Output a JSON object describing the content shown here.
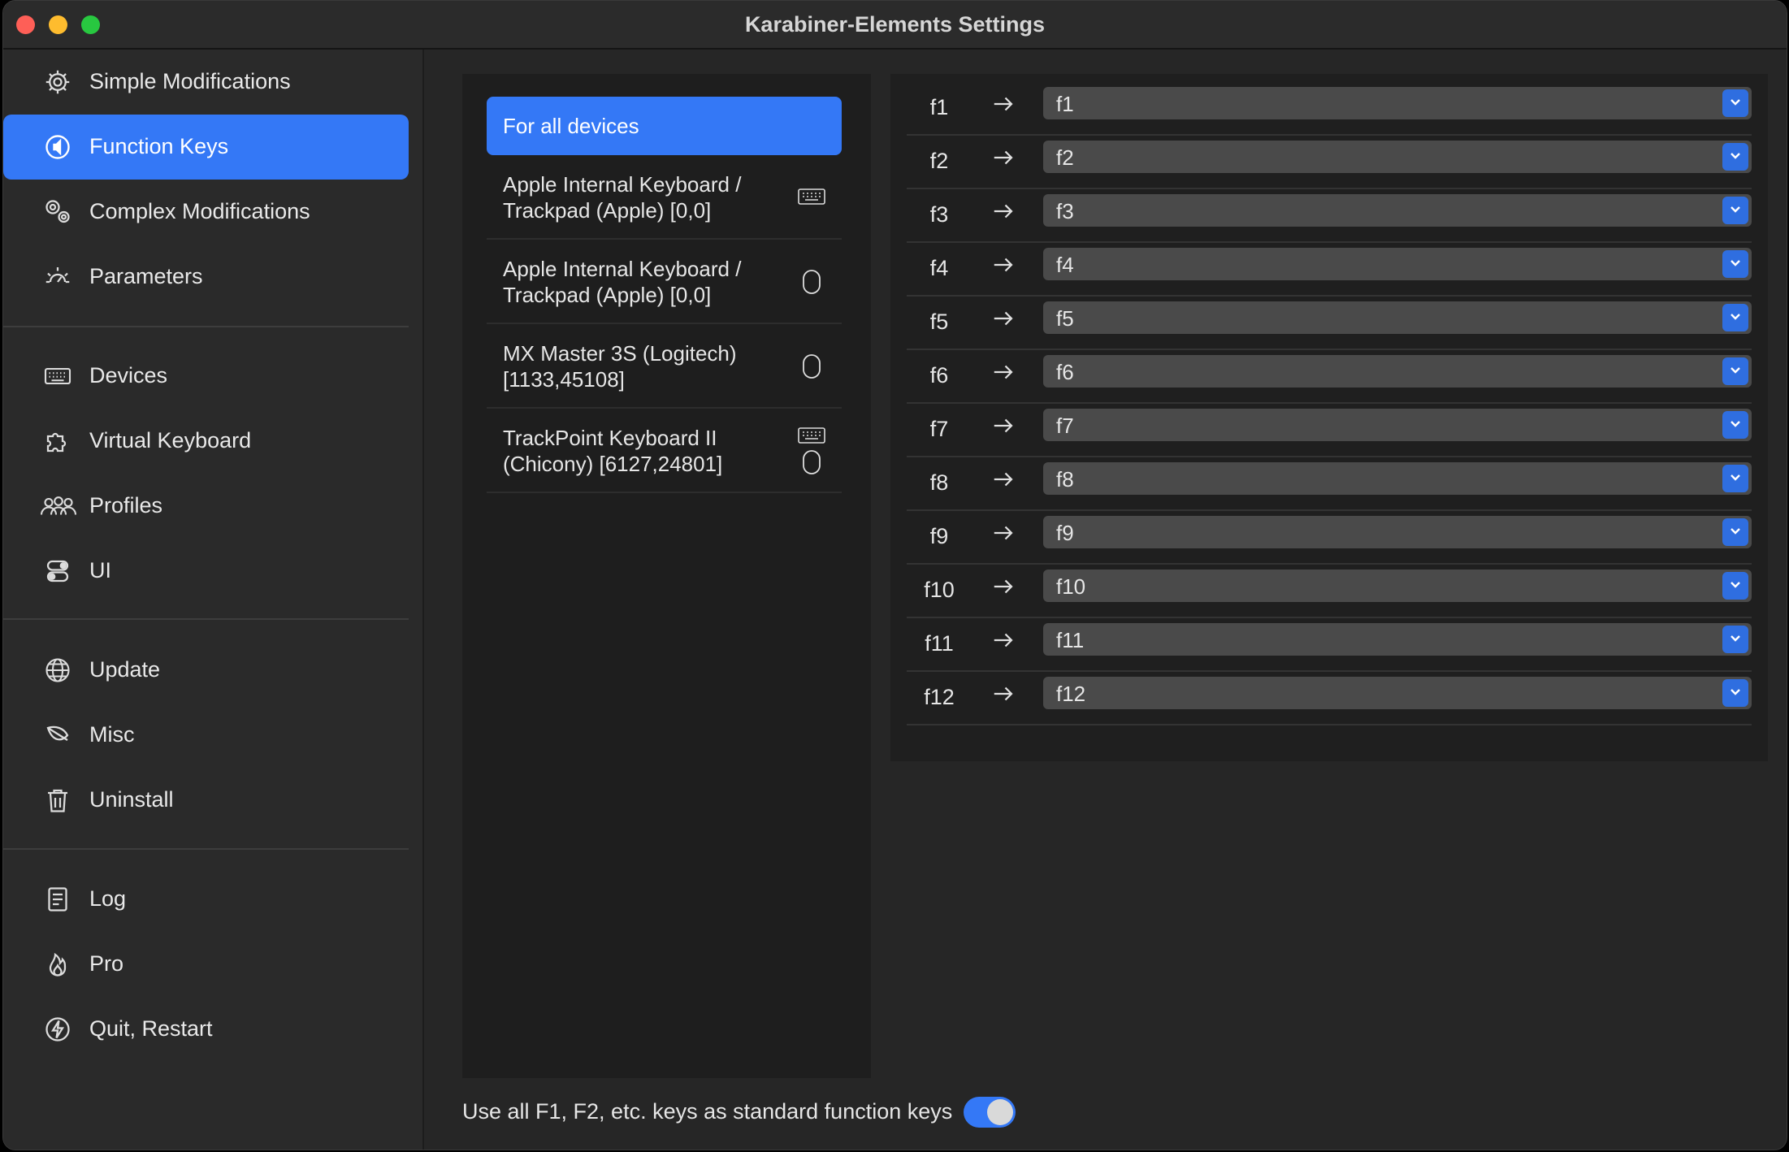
{
  "window": {
    "title": "Karabiner-Elements Settings"
  },
  "sidebar": {
    "items": [
      {
        "label": "Simple Modifications",
        "icon": "gear-icon"
      },
      {
        "label": "Function Keys",
        "icon": "function-keys-icon",
        "active": true
      },
      {
        "label": "Complex Modifications",
        "icon": "gears-icon"
      },
      {
        "label": "Parameters",
        "icon": "sun-dial-icon"
      },
      {
        "label": "Devices",
        "icon": "keyboard-icon"
      },
      {
        "label": "Virtual Keyboard",
        "icon": "puzzle-icon"
      },
      {
        "label": "Profiles",
        "icon": "people-icon"
      },
      {
        "label": "UI",
        "icon": "toggles-icon"
      },
      {
        "label": "Update",
        "icon": "globe-icon"
      },
      {
        "label": "Misc",
        "icon": "leaf-icon"
      },
      {
        "label": "Uninstall",
        "icon": "trash-icon"
      },
      {
        "label": "Log",
        "icon": "document-icon"
      },
      {
        "label": "Pro",
        "icon": "flame-icon"
      },
      {
        "label": "Quit, Restart",
        "icon": "bolt-icon"
      }
    ]
  },
  "devices": {
    "items": [
      {
        "name": "For all devices",
        "active": true,
        "icons": []
      },
      {
        "name": "Apple Internal Keyboard / Trackpad (Apple) [0,0]",
        "icons": [
          "keyboard-icon"
        ]
      },
      {
        "name": "Apple Internal Keyboard / Trackpad (Apple) [0,0]",
        "icons": [
          "mouse-icon"
        ]
      },
      {
        "name": "MX Master 3S (Logitech) [1133,45108]",
        "icons": [
          "mouse-icon"
        ]
      },
      {
        "name": "TrackPoint Keyboard II (Chicony) [6127,24801]",
        "icons": [
          "keyboard-icon",
          "mouse-icon"
        ]
      }
    ]
  },
  "function_keys": [
    {
      "from": "f1",
      "to": "f1"
    },
    {
      "from": "f2",
      "to": "f2"
    },
    {
      "from": "f3",
      "to": "f3"
    },
    {
      "from": "f4",
      "to": "f4"
    },
    {
      "from": "f5",
      "to": "f5"
    },
    {
      "from": "f6",
      "to": "f6"
    },
    {
      "from": "f7",
      "to": "f7"
    },
    {
      "from": "f8",
      "to": "f8"
    },
    {
      "from": "f9",
      "to": "f9"
    },
    {
      "from": "f10",
      "to": "f10"
    },
    {
      "from": "f11",
      "to": "f11"
    },
    {
      "from": "f12",
      "to": "f12"
    }
  ],
  "footer": {
    "toggle_label": "Use all F1, F2, etc. keys as standard function keys",
    "toggle_on": true
  },
  "colors": {
    "accent": "#3478f6",
    "close": "#fe5f57",
    "minimize": "#febc2e",
    "maximize": "#28c840"
  }
}
